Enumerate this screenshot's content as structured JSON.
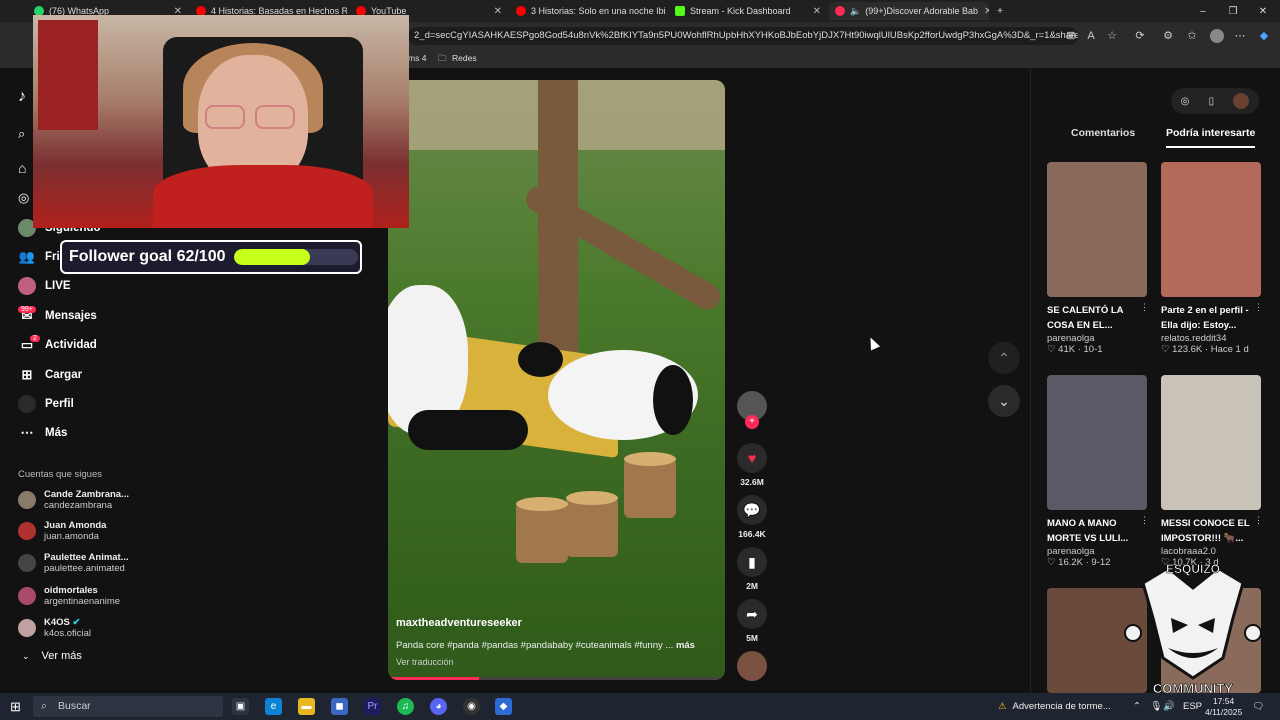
{
  "browser": {
    "tabs": [
      {
        "label": "(76) WhatsApp",
        "color": "#25d366"
      },
      {
        "label": "4 Historias: Basadas en Hechos Re",
        "color": "#ff0000"
      },
      {
        "label": "YouTube",
        "color": "#ff0000"
      },
      {
        "label": "3 Historias: Solo en una noche Ibi",
        "color": "#ff0000"
      },
      {
        "label": "Stream - Kick Dashboard",
        "color": "#53fc18"
      },
      {
        "label": "(99+)Discover Adorable Bab",
        "color": "#fe2c55"
      }
    ],
    "url": "2_d=secCgYIASAHKAESPgo8God54u8nVk%2BfKIYTa9n5PU0WohflRhUpbHhXYHKoBJbEobYjDJX7Ht90iwqlUlUBsKp2fforUwdgP3hxGgA%3D&_r=1&share_ap...",
    "bookmarks": [
      "ms 4",
      "Redes"
    ]
  },
  "sidebar": {
    "items": [
      {
        "label": "Siguiendo",
        "icon": "following-icon"
      },
      {
        "label": "Fri",
        "icon": "friends-icon"
      },
      {
        "label": "LIVE",
        "icon": "live-icon"
      },
      {
        "label": "Mensajes",
        "icon": "messages-icon",
        "badge": "99+"
      },
      {
        "label": "Actividad",
        "icon": "activity-icon",
        "badge": "2"
      },
      {
        "label": "Cargar",
        "icon": "upload-icon"
      },
      {
        "label": "Perfil",
        "icon": "profile-icon"
      },
      {
        "label": "Más",
        "icon": "more-icon"
      }
    ],
    "following_title": "Cuentas que sigues",
    "following": [
      {
        "name": "Cande Zambrana...",
        "handle": "candezambrana",
        "color": "#8a7a6a"
      },
      {
        "name": "Juan Amonda",
        "handle": "juan.amonda",
        "color": "#b03030"
      },
      {
        "name": "Paulettee Animat...",
        "handle": "paulettee.animated",
        "color": "#444444"
      },
      {
        "name": "oidmortales",
        "handle": "argentinaenanime",
        "color": "#aa4a6a"
      },
      {
        "name": "K4OS",
        "handle": "k4os.oficial",
        "color": "#c0a0a0"
      }
    ],
    "see_more": "Ver más"
  },
  "overlay": {
    "goal_text": "Follower goal 62/100",
    "goal_progress": 0.62
  },
  "video": {
    "username": "maxtheadventureseeker",
    "description": "Panda core #panda #pandas #pandababy #cuteanimals #funny",
    "more": "más",
    "translate": "Ver traducción",
    "progress": 0.27
  },
  "actions": {
    "likes": "32.6M",
    "comments": "166.4K",
    "saves": "2M",
    "shares": "5M"
  },
  "right_panel": {
    "tabs": [
      "Comentarios",
      "Podría interesarte"
    ],
    "cards": [
      {
        "title": "SE CALENTÓ LA COSA EN EL...",
        "author": "parenaolga",
        "meta": "♡ 41K · 10-1",
        "thumb_color": "#8a6a5a"
      },
      {
        "title": "Parte 2 en el perfil - Ella dijo: Estoy...",
        "author": "relatos.reddit34",
        "meta": "♡ 123.6K · Hace 1 d",
        "thumb_color": "#b46a5a"
      },
      {
        "title": "MANO A MANO MORTE VS LULI...",
        "author": "parenaolga",
        "meta": "♡ 16.2K · 9-12",
        "thumb_color": "#5a5a66"
      },
      {
        "title": "MESSI CONOCE EL IMPOSTOR!!! 🐂...",
        "author": "lacobraaa2.0",
        "meta": "♡ 10.7K · 3 d",
        "thumb_color": "#c9c2b8"
      },
      {
        "title": "",
        "author": "",
        "meta": "",
        "thumb_color": "#6a4a3a"
      },
      {
        "title": "",
        "author": "",
        "meta": "",
        "thumb_color": "#8a6a5a"
      }
    ]
  },
  "watermark": {
    "top": "ESQUIZO",
    "bottom": "COMMUNITY"
  },
  "taskbar": {
    "search": "Buscar",
    "weather": "Advertencia de torme...",
    "lang": "ESP",
    "time": "17:54",
    "date": "4/11/2025"
  }
}
